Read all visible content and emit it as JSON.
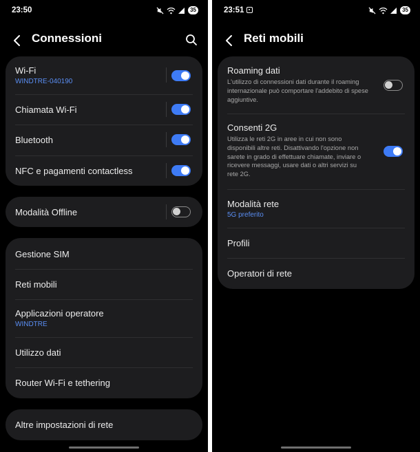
{
  "colors": {
    "background": "#000000",
    "card": "#1d1d1f",
    "accent": "#3e7bf5",
    "sublabel": "#5a8ef3",
    "text": "#ececec"
  },
  "left": {
    "status": {
      "time": "23:50",
      "battery": "35"
    },
    "header": {
      "title": "Connessioni"
    },
    "group1": [
      {
        "label": "Wi-Fi",
        "sub": "WINDTRE-040190",
        "toggle": "on"
      },
      {
        "label": "Chiamata Wi-Fi",
        "toggle": "on"
      },
      {
        "label": "Bluetooth",
        "toggle": "on"
      },
      {
        "label": "NFC e pagamenti contactless",
        "toggle": "on"
      }
    ],
    "group2": [
      {
        "label": "Modalità Offline",
        "toggle": "off"
      }
    ],
    "group3": [
      {
        "label": "Gestione SIM"
      },
      {
        "label": "Reti mobili"
      },
      {
        "label": "Applicazioni operatore",
        "sub": "WINDTRE"
      },
      {
        "label": "Utilizzo dati"
      },
      {
        "label": "Router Wi-Fi e tethering"
      }
    ],
    "group4": [
      {
        "label": "Altre impostazioni di rete"
      }
    ]
  },
  "right": {
    "status": {
      "time": "23:51",
      "battery": "35"
    },
    "header": {
      "title": "Reti mobili"
    },
    "items": [
      {
        "label": "Roaming dati",
        "desc": "L'utilizzo di connessioni dati durante il roaming internazionale può comportare l'addebito di spese aggiuntive.",
        "toggle": "off"
      },
      {
        "label": "Consenti 2G",
        "desc": "Utilizza le reti 2G in aree in cui non sono disponibili altre reti. Disattivando l'opzione non sarete in grado di effettuare chiamate, inviare o ricevere messaggi, usare dati o altri servizi su rete 2G.",
        "toggle": "on"
      },
      {
        "label": "Modalità rete",
        "sub": "5G preferito"
      },
      {
        "label": "Profili"
      },
      {
        "label": "Operatori di rete"
      }
    ]
  }
}
